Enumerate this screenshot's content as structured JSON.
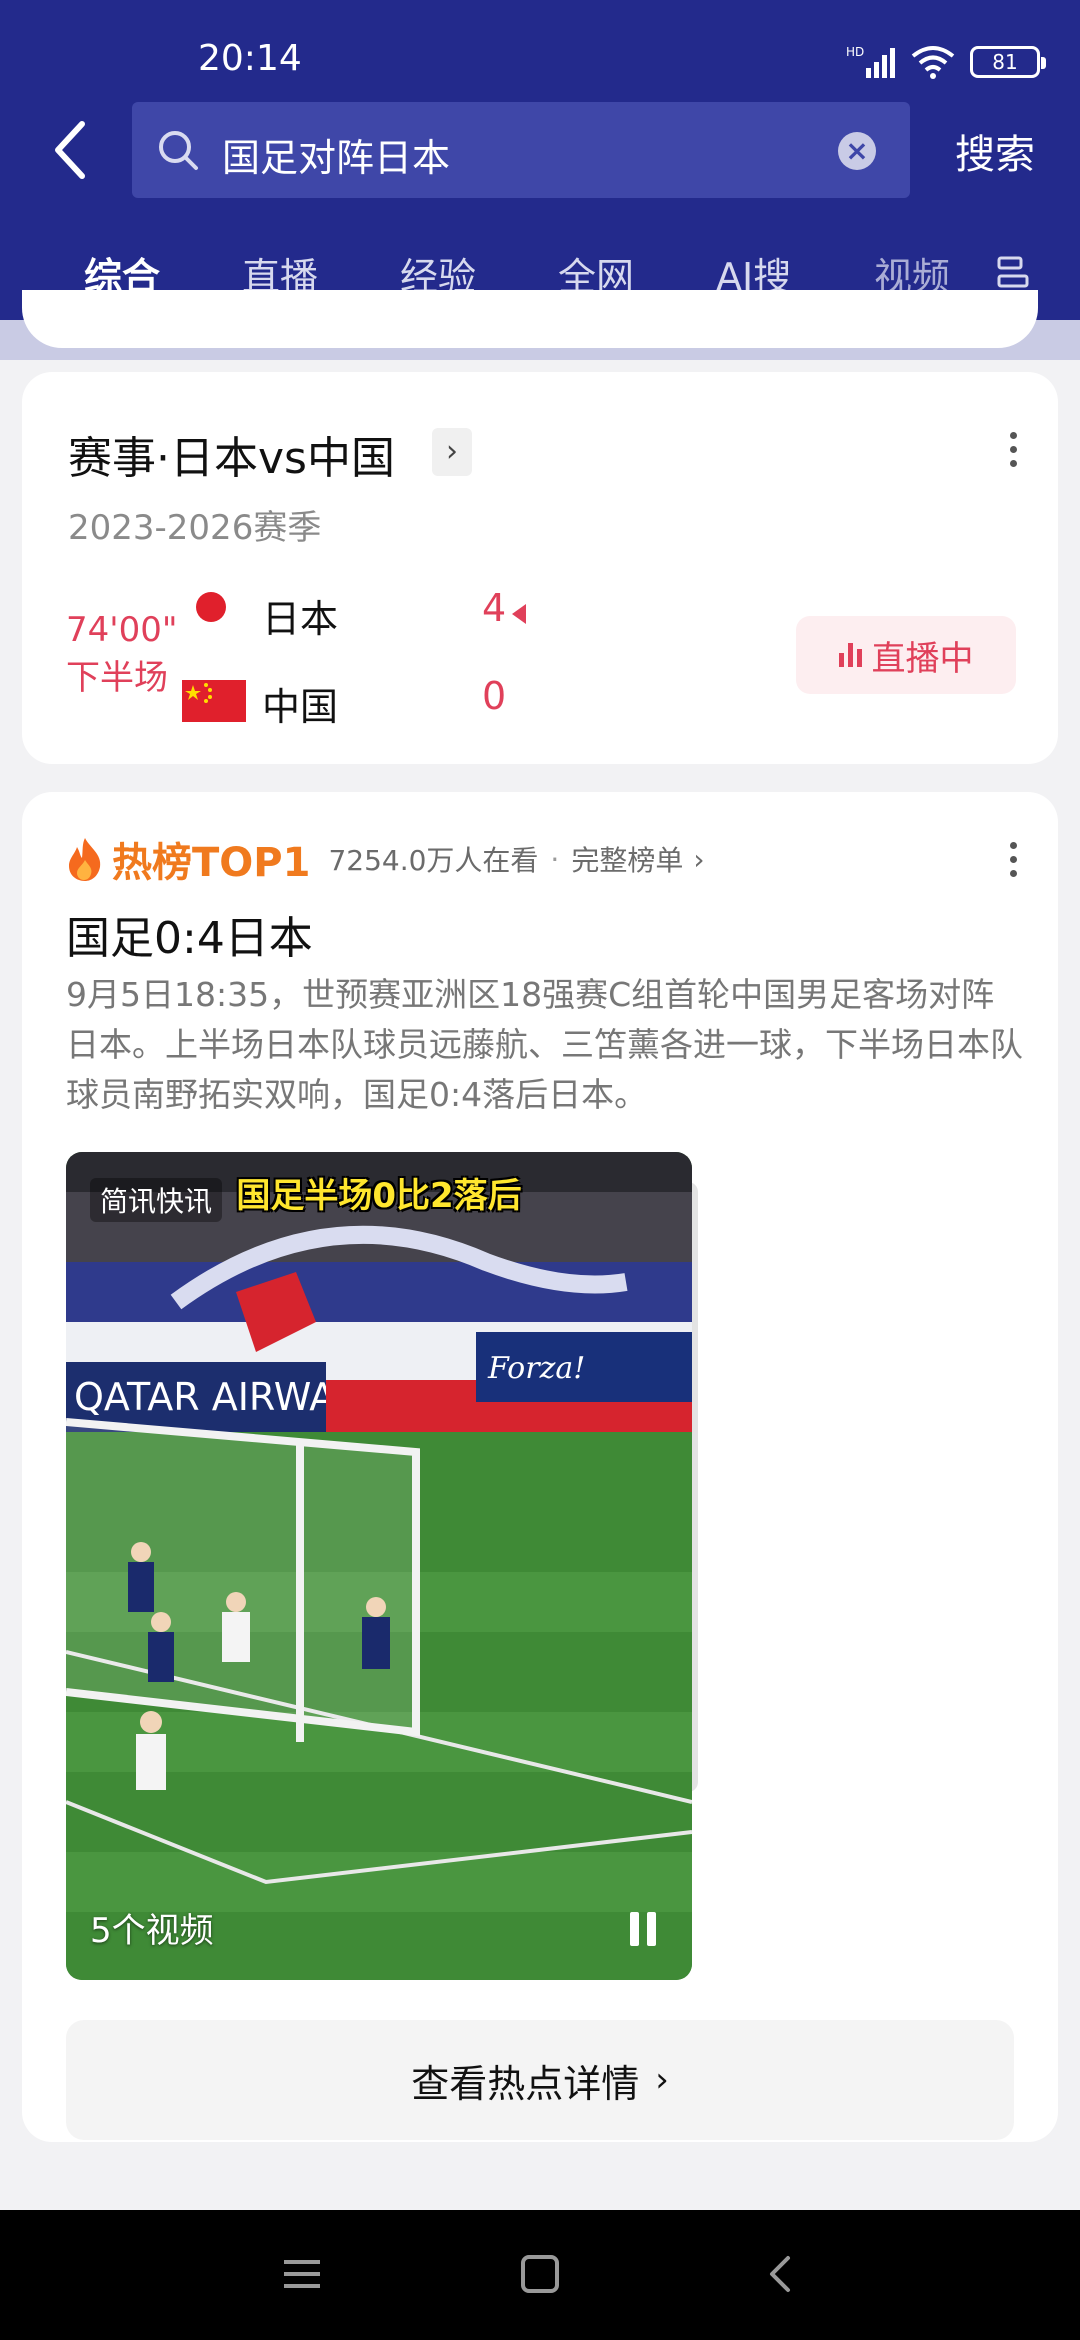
{
  "status_bar": {
    "time": "20:14",
    "network_label": "HD",
    "battery": "81"
  },
  "header": {
    "search_query": "国足对阵日本",
    "search_button": "搜索",
    "tabs": [
      {
        "label": "综合",
        "active": true
      },
      {
        "label": "直播",
        "active": false
      },
      {
        "label": "经验",
        "active": false
      },
      {
        "label": "全网",
        "active": false
      },
      {
        "label": "AI搜",
        "active": false
      },
      {
        "label": "视频",
        "active": false
      }
    ]
  },
  "match_card": {
    "title": "赛事·日本vs中国",
    "season": "2023-2026赛季",
    "clock": "74'00\"",
    "period": "下半场",
    "teams": [
      {
        "name": "日本",
        "score": "4",
        "winning": true
      },
      {
        "name": "中国",
        "score": "0",
        "winning": false
      }
    ],
    "live_label": "直播中"
  },
  "hot_card": {
    "rank_label": "热榜TOP1",
    "watching": "7254.0万人在看",
    "separator": "·",
    "full_list": "完整榜单",
    "title": "国足0:4日本",
    "description": "9月5日18:35，世预赛亚洲区18强赛C组首轮中国男足客场对阵日本。上半场日本队球员远藤航、三笘薰各进一球，下半场日本队球员南野拓实双响，国足0:4落后日本。",
    "video": {
      "tag": "简讯快讯",
      "caption": "国足半场0比2落后",
      "count": "5个视频"
    },
    "detail_button": "查看热点详情"
  },
  "colors": {
    "header_bg": "#232a8c",
    "accent_red": "#e0405a",
    "hot_orange": "#f07a1e"
  }
}
